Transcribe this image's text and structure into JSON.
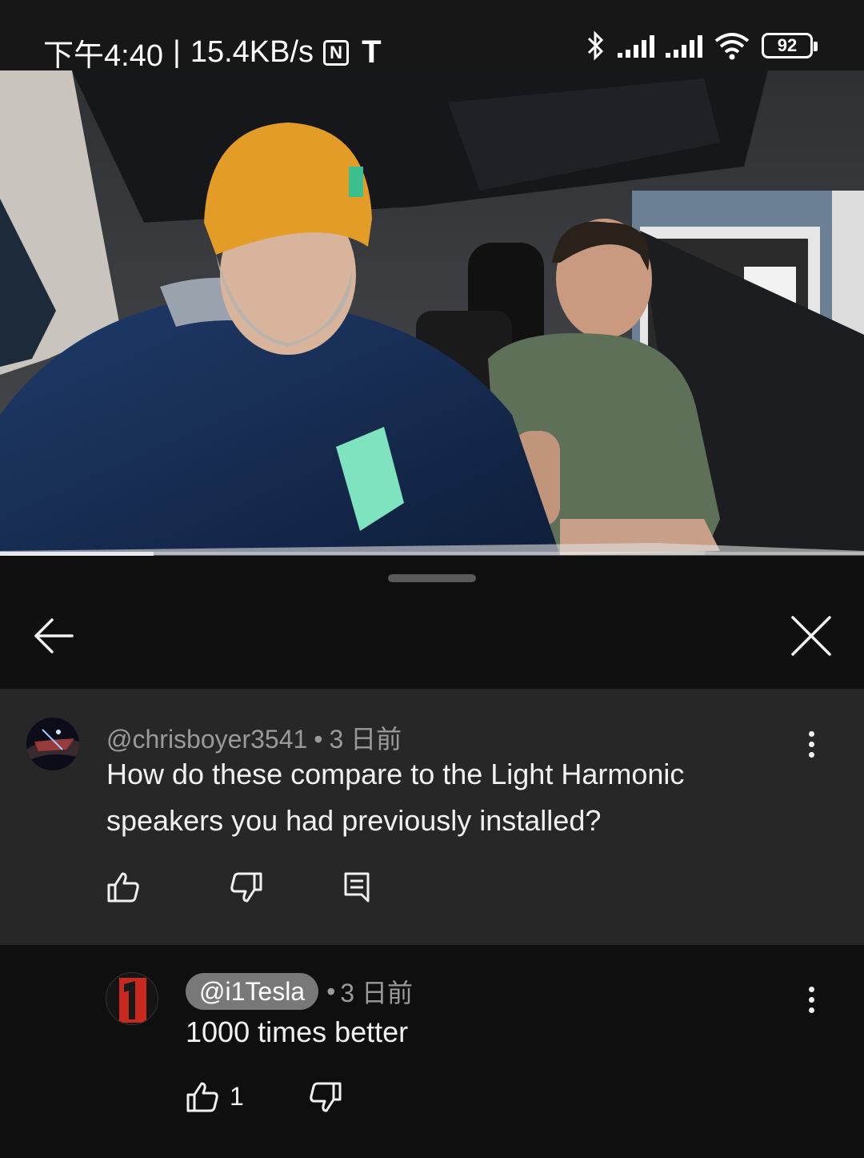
{
  "status_bar": {
    "time": "下午4:40",
    "divider": "|",
    "net_speed": "15.4KB/s",
    "nfc_label": "N",
    "tesla_glyph": "T",
    "battery": "92",
    "icons": [
      "bluetooth-icon",
      "signal-icon",
      "signal-icon",
      "wifi-icon",
      "battery-icon"
    ]
  },
  "video": {
    "progress_fraction": 0.178
  },
  "sheet": {
    "back_icon": "arrow-left-icon",
    "close_icon": "close-icon"
  },
  "comments": [
    {
      "author": "@chrisboyer3541",
      "separator": "•",
      "time": "3 日前",
      "text": "How do these compare to the Light Harmonic speakers you had previously installed?",
      "actions": [
        "like-icon",
        "dislike-icon",
        "reply-icon"
      ]
    }
  ],
  "reply": {
    "author": "@i1Tesla",
    "separator": "•",
    "time": "3 日前",
    "text": "1000 times better",
    "like_count": "1",
    "actions": [
      "like-icon",
      "dislike-icon"
    ]
  },
  "colors": {
    "background": "#0f0f0f",
    "comment_highlight": "#272727",
    "author_chip": "#787878",
    "secondary_text": "#9a9a9a"
  }
}
